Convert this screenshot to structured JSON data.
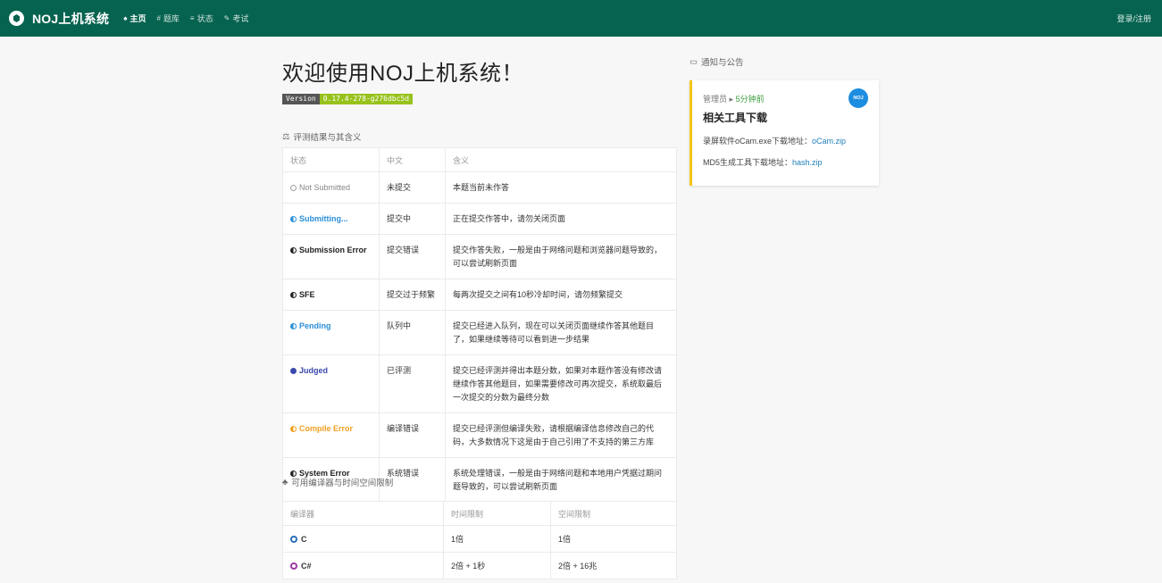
{
  "header": {
    "brand": "NOJ上机系统",
    "nav": [
      {
        "icon": "home-icon",
        "label": "主页",
        "glyph": "♠",
        "active": true
      },
      {
        "icon": "hash-icon",
        "label": "题库",
        "glyph": "#",
        "active": false
      },
      {
        "icon": "status-icon",
        "label": "状态",
        "glyph": "≡",
        "active": false
      },
      {
        "icon": "exam-icon",
        "label": "考试",
        "glyph": "✎",
        "active": false
      }
    ],
    "login": "登录/注册"
  },
  "main": {
    "title": "欢迎使用NOJ上机系统！",
    "version_key": "Version",
    "version_value": "0.17.4-278-g276dbc5d",
    "section_status": "评测结果与其含义",
    "status_headers": [
      "状态",
      "中文",
      "含义"
    ],
    "statuses": [
      {
        "name": "Not Submitted",
        "zh": "未提交",
        "desc": "本题当前未作答",
        "color": "#9e9e9e",
        "style": "ring"
      },
      {
        "name": "Submitting...",
        "zh": "提交中",
        "desc": "正在提交作答中，请勿关闭页面",
        "color": "#2a8fd6",
        "style": "half"
      },
      {
        "name": "Submission Error",
        "zh": "提交错误",
        "desc": "提交作答失败，一般是由于网络问题和浏览器问题导致的，可以尝试刷新页面",
        "color": "#222222",
        "style": "half"
      },
      {
        "name": "SFE",
        "zh": "提交过于频繁",
        "desc": "每两次提交之间有10秒冷却时间，请勿频繁提交",
        "color": "#222222",
        "style": "half"
      },
      {
        "name": "Pending",
        "zh": "队列中",
        "desc": "提交已经进入队列，现在可以关闭页面继续作答其他题目了，如果继续等待可以看到进一步结果",
        "color": "#2a8fd6",
        "style": "half"
      },
      {
        "name": "Judged",
        "zh": "已评测",
        "desc": "提交已经评测并得出本题分数，如果对本题作答没有修改请继续作答其他题目，如果需要修改可再次提交，系统取最后一次提交的分数为最终分数",
        "color": "#3949ab",
        "style": "full"
      },
      {
        "name": "Compile Error",
        "zh": "编译错误",
        "desc": "提交已经评测但编译失败，请根据编译信息修改自己的代码，大多数情况下这是由于自己引用了不支持的第三方库",
        "color": "#f0a020",
        "style": "half"
      },
      {
        "name": "System Error",
        "zh": "系统错误",
        "desc": "系统处理错误，一般是由于网络问题和本地用户凭据过期问题导致的，可以尝试刷新页面",
        "color": "#222222",
        "style": "half"
      }
    ],
    "section_compilers": "可用编译器与时间空间限制",
    "compiler_headers": [
      "编译器",
      "时间限制",
      "空间限制"
    ],
    "compilers": [
      {
        "name": "C",
        "time": "1倍",
        "space": "1倍",
        "color": "#2a6fb8"
      },
      {
        "name": "C#",
        "time": "2倍 + 1秒",
        "space": "2倍 + 16兆",
        "color": "#9b3aa6"
      }
    ]
  },
  "sidebar": {
    "title": "通知与公告",
    "card": {
      "author": "管理员",
      "time": "5分钟前",
      "avatar_text": "NOJ",
      "title": "相关工具下载",
      "lines": [
        {
          "text": "录屏软件oCam.exe下载地址：",
          "link": "oCam.zip"
        },
        {
          "text": "MD5生成工具下载地址：",
          "link": "hash.zip"
        }
      ]
    }
  },
  "colors": {
    "header_bg": "#06634f",
    "accent_border": "#f5c518",
    "version_bg": "#97c21d"
  }
}
